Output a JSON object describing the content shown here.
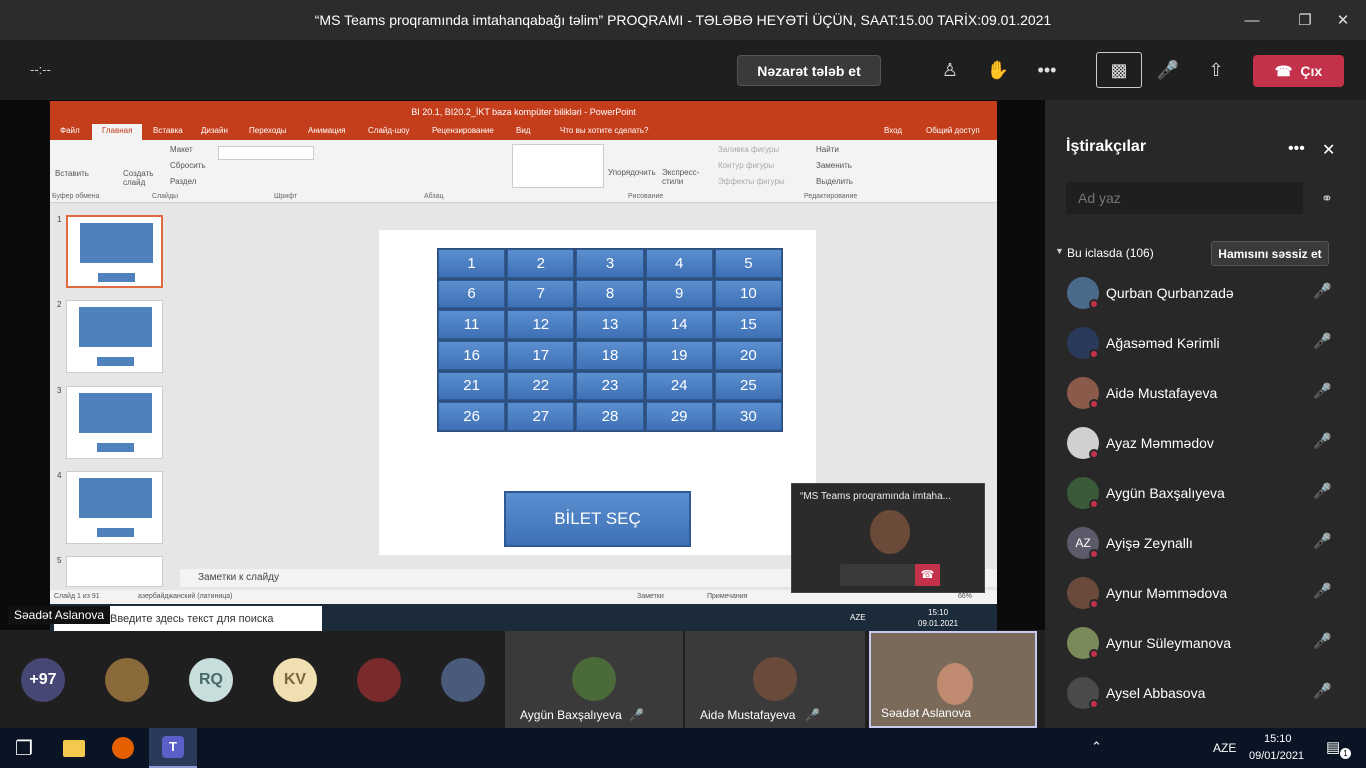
{
  "teams": {
    "window_title": "“MS Teams proqramında imtahanqabağı təlim” PROQRAMI - TƏLƏBƏ HEYƏTİ ÜÇÜN, SAAT:15.00 TARİX:09.01.2021",
    "timer": "--:--",
    "request_control_label": "Nəzarət tələb et",
    "leave_label": "Çıx",
    "icons": {
      "minimize": "minimize-icon",
      "maximize": "maximize-icon",
      "close": "close-icon",
      "participants": "people-icon",
      "raise_hand": "hand-icon",
      "more": "more-icon",
      "camera": "camera-off-icon",
      "mic": "mic-off-icon",
      "share": "share-icon",
      "leave": "phone-hangup-icon"
    }
  },
  "powerpoint": {
    "title": "BI 20.1, BI20.2_İKT baza kompüter bilikləri - PowerPoint",
    "tabs": [
      "Файл",
      "Главная",
      "Вставка",
      "Дизайн",
      "Переходы",
      "Анимация",
      "Слайд-шоу",
      "Рецензирование",
      "Вид",
      "Что вы хотите сделать?"
    ],
    "login": "Вход",
    "share": "Общий доступ",
    "groups": [
      "Буфер обмена",
      "Слайды",
      "Шрифт",
      "Абзац",
      "Рисование",
      "Редактирование"
    ],
    "ribbon_items": {
      "paste": "Вставить",
      "create_slide": "Создать слайд",
      "layout": "Макет",
      "reset": "Сбросить",
      "section": "Раздел",
      "arrange": "Упорядочить",
      "express_styles": "Экспресс-стили",
      "fill": "Заливка фигуры",
      "outline": "Контур фигуры",
      "effects": "Эффекты фигуры",
      "find": "Найти",
      "replace": "Заменить",
      "select": "Выделить"
    },
    "thumbnail_numbers": [
      "1",
      "2",
      "3",
      "4",
      "5"
    ],
    "slide": {
      "grid_numbers": [
        "1",
        "2",
        "3",
        "4",
        "5",
        "6",
        "7",
        "8",
        "9",
        "10",
        "11",
        "12",
        "13",
        "14",
        "15",
        "16",
        "17",
        "18",
        "19",
        "20",
        "21",
        "22",
        "23",
        "24",
        "25",
        "26",
        "27",
        "28",
        "29",
        "30"
      ],
      "button_label": "BİLET SEÇ"
    },
    "notes_placeholder": "Заметки к слайду",
    "status": {
      "slide": "Слайд 1 из 91",
      "language": "азербайджанский (латиница)",
      "notes": "Заметки",
      "comments": "Примечания",
      "zoom": "66%"
    },
    "inner_taskbar": {
      "search": "Введите здесь текст для поиска",
      "lang": "AZE",
      "time": "15:10",
      "date": "09.01.2021"
    },
    "presenter": "Səadət Aslanova",
    "self_view_title": "“MS Teams proqramında imtaha..."
  },
  "participants": {
    "title": "İştirakçılar",
    "search_placeholder": "Ad yaz",
    "section_label": "Bu iclasda (106)",
    "mute_all_label": "Hamısını səssiz et",
    "list": [
      {
        "name": "Qurban Qurbanzadə",
        "avatar": "photo"
      },
      {
        "name": "Ağasəməd Kərimli",
        "avatar": "photo"
      },
      {
        "name": "Aidə Mustafayeva",
        "avatar": "photo"
      },
      {
        "name": "Ayaz Məmmədov",
        "avatar": "photo"
      },
      {
        "name": "Aygün Baxşalıyeva",
        "avatar": "photo"
      },
      {
        "name": "Ayişə Zeynallı",
        "avatar": "AZ"
      },
      {
        "name": "Aynur Məmmədova",
        "avatar": "photo"
      },
      {
        "name": "Aynur Süleymanova",
        "avatar": "photo"
      },
      {
        "name": "Aysel Abbasova",
        "avatar": "photo"
      }
    ]
  },
  "gallery": {
    "overflow": "+97",
    "initials": [
      "RQ",
      "KV"
    ],
    "tiles": [
      "Aygün Baxşalıyeva",
      "Aidə Mustafayeva",
      "Səadət Aslanova"
    ]
  },
  "windows_taskbar": {
    "lang": "AZE",
    "time": "15:10",
    "date": "09/01/2021",
    "notifications": "1"
  }
}
